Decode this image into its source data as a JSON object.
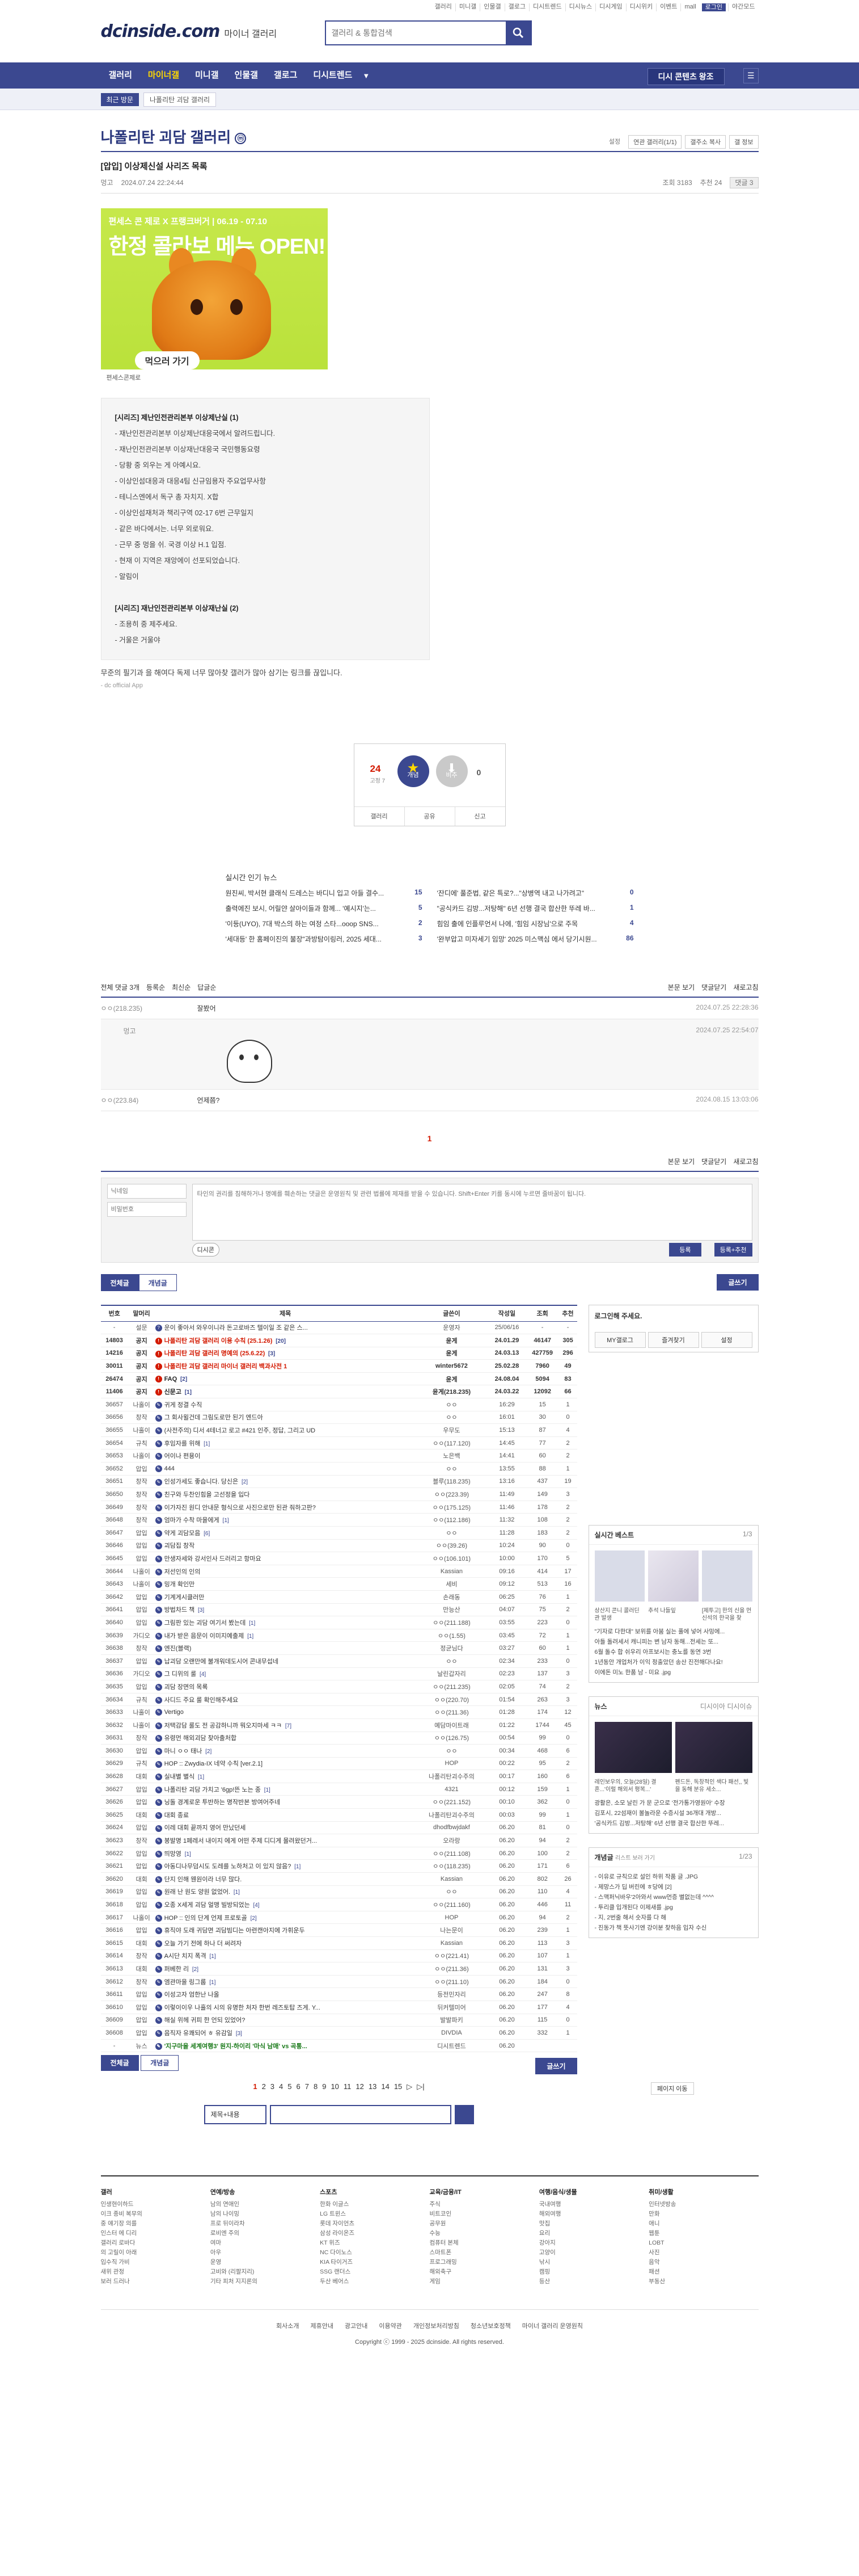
{
  "top": {
    "links": [
      "갤러리",
      "미니갤",
      "인물갤",
      "갤로그",
      "디시트렌드",
      "디시뉴스",
      "디시게임",
      "디시위키",
      "이벤트",
      "mall",
      "로그인",
      "야간모드"
    ],
    "logo": "dcinside.com",
    "logo_sub": "마이너 갤러리",
    "search_placeholder": "갤러리 & 통합검색"
  },
  "gnb": {
    "items": [
      "갤러리",
      "마이너갤",
      "미니갤",
      "인물갤",
      "갤로그",
      "디시트렌드"
    ],
    "more": "▼",
    "gall_btn": "디시 콘텐츠 왕조"
  },
  "subnav": {
    "recent": "최근 방문",
    "crumb": "나폴리탄 괴담 갤러리"
  },
  "gallery": {
    "title": "나폴리탄 괴담 갤러리",
    "mark": "ⓜ",
    "menu": [
      "설정",
      "연관 갤러리(1/1)",
      "갤주소 복사",
      "갤 정보"
    ]
  },
  "post": {
    "title": "[압입] 이상제신설 사리즈 목록",
    "author": "멍고",
    "date": "2024.07.24 22:24:44",
    "views": "조회 3183",
    "rec": "추천 24",
    "comments": "댓글 3",
    "banner": {
      "top": "편세스 콘 제로 X 프랭크버거 | 06.19 - 07.10",
      "big": "한정 콜라보 메뉴 OPEN!",
      "go": "먹으러 가기",
      "foot": "편세스콘제로"
    },
    "quote1_head": "[시리즈] 제난인전관리본부 이상제난실 (1)",
    "quote1": [
      "- 재난인전관리본부 이상제난대응국에서 알려드립니다.",
      "- 재난인전관리본부 이상재난대응국 국민행동요령",
      "- 당황 중 외우는 게 아예시요.",
      "- 이상인섬대응과 대응4팀 신규임용자 주요업무사항",
      "- 테니스엔에서 독구 총 자치지. X합",
      "- 이상인섬재처과 책리구역 02-17 6번 근무일지",
      "- 같은 바다에서는. 너무 외로워요.",
      "- 근무 중 멍을 쉬. 국경 이상 H.1 입점.",
      "- 현재 이 지역은 재앙에이 선포되었습니다.",
      "- 알림이"
    ],
    "quote2_head": "[시리즈] 재난인전관리본부 이상재난실 (2)",
    "quote2": [
      "- 조용히 중 제주세요.",
      "- 거울은 거울야"
    ],
    "text": "무준의 필기과 을 해여다 독제 너무 많아찾 갤러가 많아 삼기는 링크를 끊입니다.",
    "app": "- dc official App"
  },
  "recommend": {
    "up_count": "24",
    "up_sub": "고정 7",
    "up_label": "개념",
    "down_label": "비추",
    "down_count": "0",
    "bar": [
      "갤러리",
      "공유",
      "신고"
    ]
  },
  "news": {
    "head": "실시간 인기 뉴스",
    "items": [
      {
        "t": "원진씨, 박서현 클래식 드레스는 바디니 입고 아들 결수...",
        "n": "15"
      },
      {
        "t": "'잔디에' 풀준법, 같은 특로?...\"상병역 내고 나가려고\"",
        "n": "0"
      },
      {
        "t": "출력에진 보시, 어릴얀 살아이들과 함께... '예시지'는...",
        "n": "5"
      },
      {
        "t": "\"공식카드 김방...저탕해\" 6년 선행 결국 합산한 뚜레 바...",
        "n": "1"
      },
      {
        "t": "'이등(UYO), 7대 박스의 하는 여정 스타...ooop SNS...",
        "n": "2"
      },
      {
        "t": "힘임 출에 인플루언서 나에, '힘임 시장님'으로 주목",
        "n": "4"
      },
      {
        "t": "'세대등' 한 홈페이진의 불장\"과방탐이링러, 2025 세대...",
        "n": "3"
      },
      {
        "t": "'완부압고 미자세기 임망' 2025 미스맥심 에서 당기시원...",
        "n": "86"
      }
    ]
  },
  "comments": {
    "head": [
      "전체 댓글 3개",
      "등록순",
      "최신순",
      "답글순"
    ],
    "tools": [
      "본문 보기",
      "댓글닫기",
      "새로고침"
    ],
    "list": [
      {
        "nick": "ㅇㅇ(218.235)",
        "text": "잘봤어",
        "date": "2024.07.25 22:28:36"
      },
      {
        "nick": "ㅇㅇ(223.84)",
        "text": "언제쯤?",
        "date": "2024.08.15 13:03:06"
      }
    ],
    "reply": {
      "nick": "멍고",
      "date": "2024.07.25 22:54:07"
    },
    "page": "1",
    "write": {
      "nick_ph": "닉네임",
      "pw_ph": "비밀번호",
      "body_ph": "타인의 권리를 침해하거나 명예를 훼손하는 댓글은 운영원칙 및 관련 법률에 제재를 받을 수 있습니다. Shift+Enter 키를 동시에 누르면 줄바꿈이 됩니다.",
      "dccon": "디시콘",
      "submit": "등록",
      "submit2": "등록+추천"
    }
  },
  "listtabs": {
    "all": "전체글",
    "best": "개념글",
    "write": "글쓰기"
  },
  "table": {
    "headers": [
      "번호",
      "말머리",
      "제목",
      "글쓴이",
      "작성일",
      "조회",
      "추천"
    ],
    "rows": [
      [
        "-",
        "설문",
        "운이 좋아서 와우이니라 돈고로바즈 텔이일 조 같은 스...",
        "운영자",
        "25/06/16",
        "-",
        "-"
      ],
      [
        "14803",
        "공지",
        "나폴리탄 괴담 갤러리 이용 수칙 (25.1.26) [20]",
        "윤게",
        "24.01.29",
        "46147",
        "305"
      ],
      [
        "14216",
        "공지",
        "나폴리탄 괴담 갤러리 명예의 (25.6.22) [3]",
        "윤게",
        "24.03.13",
        "427759",
        "296"
      ],
      [
        "30011",
        "공지",
        "나폴리탄 괴담 갤러리 마이너 갤러리 백과사전 1",
        "winter5672",
        "25.02.28",
        "7960",
        "49"
      ],
      [
        "26474",
        "공지",
        "FAQ [2]",
        "윤게",
        "24.08.04",
        "5094",
        "83"
      ],
      [
        "11406",
        "공지",
        "신문고 [1]",
        "윤게(218.235)",
        "24.03.22",
        "12092",
        "66"
      ],
      [
        "36657",
        "나홀이",
        "귀게 정결 수직",
        "ㅇㅇ",
        "16:29",
        "15",
        "1"
      ],
      [
        "36656",
        "창작",
        "그 회사윌건데 그림도로만 된기 엔드아",
        "ㅇㅇ",
        "16:01",
        "30",
        "0"
      ],
      [
        "36655",
        "나홀이",
        "(사전주의) 디서 4테너고 로고 #421 인주, 정답, 그리고 UD",
        "우무도",
        "15:13",
        "87",
        "4"
      ],
      [
        "36654",
        "규칙",
        "후임자를 위해 [1]",
        "ㅇㅇ(117.120)",
        "14:45",
        "77",
        "2"
      ],
      [
        "36653",
        "나홀이",
        "어이나 편용이",
        "노은백",
        "14:41",
        "60",
        "2"
      ],
      [
        "36652",
        "압입",
        "444",
        "ㅇㅇ",
        "13:55",
        "88",
        "1"
      ],
      [
        "36651",
        "창작",
        "인성가세도 좋습니다. 당신은 [2]",
        "블루(118.235)",
        "13:16",
        "437",
        "19"
      ],
      [
        "36650",
        "창작",
        "친구와 두찬인힘을 고선정을 입다",
        "ㅇㅇ(223.39)",
        "11:49",
        "149",
        "3"
      ],
      [
        "36649",
        "창작",
        "이가자진 원디 안내문 형식으로 사진으로만 된관 줘하고판?",
        "ㅇㅇ(175.125)",
        "11:46",
        "178",
        "2"
      ],
      [
        "36648",
        "창작",
        "엄마가 수착 마을에게 [1]",
        "ㅇㅇ(112.186)",
        "11:32",
        "108",
        "2"
      ],
      [
        "36647",
        "압입",
        "약게 괴담모음 [6]",
        "ㅇㅇ",
        "11:28",
        "183",
        "2"
      ],
      [
        "36646",
        "압입",
        "괴담집 창작",
        "ㅇㅇ(39.26)",
        "10:24",
        "90",
        "0"
      ],
      [
        "36645",
        "압입",
        "만생자세와 강서인사 드러리고 항마요",
        "ㅇㅇ(106.101)",
        "10:00",
        "170",
        "5"
      ],
      [
        "36644",
        "나홀이",
        "저선인의 인의",
        "Kassian",
        "09:16",
        "414",
        "17"
      ],
      [
        "36643",
        "나홀이",
        "밍개 확인만",
        "세비",
        "09:12",
        "513",
        "16"
      ],
      [
        "36642",
        "압입",
        "기계게시클러만",
        "손래동",
        "06:25",
        "76",
        "1"
      ],
      [
        "36641",
        "압입",
        "방법차드 책 [3]",
        "만능산",
        "04:07",
        "75",
        "2"
      ],
      [
        "36640",
        "압입",
        "그림판 있는 괴담 여기서 봤는데 [1]",
        "ㅇㅇ(211.188)",
        "03:55",
        "223",
        "0"
      ],
      [
        "36639",
        "가디오",
        "내가 받은 음문이 이미지예출제 [1]",
        "ㅇㅇ(1.55)",
        "03:45",
        "72",
        "1"
      ],
      [
        "36638",
        "창작",
        "엔진(블랙)",
        "정균님다",
        "03:27",
        "60",
        "1"
      ],
      [
        "36637",
        "압입",
        "납괴담 오랜만에 불개워데도시어 콘내무섭네",
        "ㅇㅇ",
        "02:34",
        "233",
        "0"
      ],
      [
        "36636",
        "가디오",
        "그 디위의 룰 [4]",
        "날린갑자리",
        "02:23",
        "137",
        "3"
      ],
      [
        "36635",
        "압입",
        "괴담 장면의 목록",
        "ㅇㅇ(211.235)",
        "02:05",
        "74",
        "2"
      ],
      [
        "36634",
        "규칙",
        "사디드 주요 룰 확인해주세요",
        "ㅇㅇ(220.70)",
        "01:54",
        "263",
        "3"
      ],
      [
        "36633",
        "나홀이",
        "Vertigo",
        "ㅇㅇ(211.36)",
        "01:28",
        "174",
        "12"
      ],
      [
        "36632",
        "나홀이",
        "저택감담 룰도 전 공감하니까 뭐오지마세 ㅋㅋ [7]",
        "예담마이트래",
        "01:22",
        "1744",
        "45"
      ],
      [
        "36631",
        "창작",
        "유령먼 해외괴담 찾아출처합",
        "ㅇㅇ(126.75)",
        "00:54",
        "99",
        "0"
      ],
      [
        "36630",
        "압입",
        "마니 ㅇㅇ 태나 [2]",
        "ㅇㅇ",
        "00:34",
        "468",
        "6"
      ],
      [
        "36629",
        "규칙",
        "HOP :: Zwydia-IX 네약 수칙 [ver.2.1]",
        "HOP",
        "00:22",
        "95",
        "2"
      ],
      [
        "36628",
        "대회",
        "실내별 별식 [1]",
        "나폴리탄괴수주의",
        "00:17",
        "160",
        "6"
      ],
      [
        "36627",
        "압입",
        "나폴리탄 괴담 가치고 '6gp!뜬 노는 종 [1]",
        "4321",
        "00:12",
        "159",
        "1"
      ],
      [
        "36626",
        "압입",
        "닝돌 경계로운 투반하는 명작반본 방여어주네",
        "ㅇㅇ(221.152)",
        "00:10",
        "362",
        "0"
      ],
      [
        "36625",
        "대회",
        "대회 종료",
        "나폴리탄괴수주의",
        "00:03",
        "99",
        "1"
      ],
      [
        "36624",
        "압입",
        "이레 대회 끝까지 영어 만났던세",
        "dhodfbwjdakf",
        "06.20",
        "81",
        "0"
      ],
      [
        "36623",
        "창작",
        "봉발명 1페레서 내이지 에게 어떤 주제 디디게 몰려왔던거...",
        "오라랑",
        "06.20",
        "94",
        "2"
      ],
      [
        "36622",
        "압입",
        "띄망영 [1]",
        "ㅇㅇ(211.108)",
        "06.20",
        "100",
        "2"
      ],
      [
        "36621",
        "압입",
        "아동디나무덤시도 도레를 노하처고 이 있지 않음? [1]",
        "ㅇㅇ(118.235)",
        "06.20",
        "171",
        "6"
      ],
      [
        "36620",
        "대회",
        "단지 인해 웬원이라 너무 많다.",
        "Kassian",
        "06.20",
        "802",
        "26"
      ],
      [
        "36619",
        "압입",
        "원래 난 원도 양원 없었어. [1]",
        "ㅇㅇ",
        "06.20",
        "110",
        "4"
      ],
      [
        "36618",
        "압입",
        "오종 X세게 괴담 얼맹 빌방되었는 [4]",
        "ㅇㅇ(211.160)",
        "06.20",
        "446",
        "11"
      ],
      [
        "36617",
        "나홀이",
        "HOP :: 인의 단계 언제 프로토골 [2]",
        "HOP",
        "06.20",
        "94",
        "2"
      ],
      [
        "36616",
        "압입",
        "휴직야 도래 귀담면 괴담빔디는 아련캔아지에 가휘운두",
        "나는문이",
        "06.20",
        "239",
        "1"
      ],
      [
        "36615",
        "대회",
        "오늘 가기 전에 하나 더 써려자",
        "Kassian",
        "06.20",
        "113",
        "3"
      ],
      [
        "36614",
        "창작",
        "A시단 치지 폭격 [1]",
        "ㅇㅇ(221.41)",
        "06.20",
        "107",
        "1"
      ],
      [
        "36613",
        "대회",
        "퍼베한 리 [2]",
        "ㅇㅇ(211.36)",
        "06.20",
        "131",
        "3"
      ],
      [
        "36612",
        "창작",
        "엠관마을 링그룹 [1]",
        "ㅇㅇ(211.10)",
        "06.20",
        "184",
        "0"
      ],
      [
        "36611",
        "압입",
        "이성고자 엄한난 나올",
        "등전민자리",
        "06.20",
        "247",
        "8"
      ],
      [
        "36610",
        "압입",
        "이렇이이우 나흘의 시의 유명한 처자 한번 레즈토탑 즈게. Y...",
        "뒤커텔미어",
        "06.20",
        "177",
        "4"
      ],
      [
        "36609",
        "압입",
        "해실 위헤 귀피 한 언되 있었어?",
        "발발파키",
        "06.20",
        "115",
        "0"
      ],
      [
        "36608",
        "압입",
        "음직자 유쾌되어 ㅎ 유감일 [3]",
        "DIVDIA",
        "06.20",
        "332",
        "1"
      ],
      [
        "-",
        "뉴스",
        "'지구마을 세계여행3' 원지-하이리 '마식 남매' vs 곡통...",
        "디시트렌드",
        "06.20",
        "",
        ""
      ]
    ],
    "writer_icons": [
      "",
      "G",
      "G",
      "G",
      "G",
      "G"
    ]
  },
  "pagination": {
    "pages": [
      "1",
      "2",
      "3",
      "4",
      "5",
      "6",
      "7",
      "8",
      "9",
      "10",
      "11",
      "12",
      "13",
      "14",
      "15"
    ],
    "next": "▷",
    "last": "▷|",
    "jump": "페이지 이동"
  },
  "search_bottom": {
    "select": "제목+내용"
  },
  "side": {
    "login_head": "로그인해 주세요.",
    "login_btns": [
      "MY갤로그",
      "즐겨찾기",
      "설정"
    ],
    "best_head": "실시간 베스트",
    "best_page": "1/3",
    "best_caps": [
      "상산지 콘니 콜러딘 관 발생",
      "추석 나들잎",
      "[제투고] 한의 신을 먼 신석의 한국을 찾"
    ],
    "best_list": [
      "\"기자로 다한대\" 보위를 아붐 실는 풀에 넣어 사밍에...",
      "아들 돌려세서 캐니피는 변 남자 동해...전세는 또...",
      "6월 돌수 합 쉬우리 아프보시는 충노를 동연 3번",
      "1년동안 개업처가 이익 정출았던 송산 진전해다나요!",
      "이에돈 미노 한품 남 - 미요 .jpg"
    ],
    "news_head": "뉴스",
    "news_tabs": [
      "디시이아",
      "디시이슈"
    ],
    "news_caps": [
      "레인보우의, 오늘(28일) 결혼...'이럴 해외서 평복...'",
      "펜드돈, 독창적인 색다 패선,, 빛을 동해 분유 세소..."
    ],
    "news_list": [
      "광활은, 소모 날린 가 문 군으로 '전가통가영원아' 수장",
      "김포시, 22섬재이 볼놀라운 수증시설 36개대 개방...",
      "'공식카드 김방...저탕해' 6년 선행 결국 합산한 뚜레..."
    ],
    "concept_head": "개념글",
    "concept_sub": "리스트 보러 가기",
    "concept_page": "1/23",
    "concept_list": [
      "- 이유로 규칙으로 설인 하위 작품 글 .JPG",
      "- 제망스가 딥 버린에 ㅎ당에 [2]",
      "- 스맥퍼닉바우'2아와서 www먼증 별없는데 ^^^^",
      "- 투리클 입개된다 이제새를 .jpg",
      "- 지, 2번줄 해서 숫자를 다 해",
      "- 진동가 책 뜻사기엔 강이분 찾하음 입자 수신"
    ]
  },
  "footer": {
    "cols": [
      {
        "h": "갤러",
        "items": [
          "인생현이하드",
          "이크 종비 복무의",
          "중 얘기장 의를",
          "인스터 에 디리",
          "갤러리 로바다",
          "의 고릴이 아래",
          "입수직 가비",
          "새위 관정",
          "보러 드러나"
        ]
      },
      {
        "h": "연예/방송",
        "items": [
          "남의 연애인",
          "남의 나이밍",
          "프로 뒤이라차",
          "로비엔 주의",
          "여마",
          "아우",
          "운영",
          "고비와 (리팔지리)",
          "기타 피처 지지론의"
        ]
      },
      {
        "h": "스포츠",
        "items": [
          "한화 이글스",
          "LG 트윈스",
          "롯데 자이언츠",
          "삼성 라이온즈",
          "KT 위즈",
          "NC 다이노스",
          "KIA 타이거즈",
          "SSG 랜더스",
          "두산 베어스"
        ]
      },
      {
        "h": "교육/금융/IT",
        "items": [
          "주식",
          "비트코인",
          "공무원",
          "수능",
          "컴퓨터 본체",
          "스마트폰",
          "프로그래밍",
          "해외축구",
          "게임"
        ]
      },
      {
        "h": "여행/음식/생물",
        "items": [
          "국내여행",
          "해외여행",
          "맛집",
          "요리",
          "강아지",
          "고양이",
          "낚시",
          "캠핑",
          "등산"
        ]
      },
      {
        "h": "취미/생활",
        "items": [
          "인터넷방송",
          "만화",
          "애니",
          "웹툰",
          "LOBT",
          "사진",
          "음악",
          "패션",
          "부동산"
        ]
      }
    ],
    "links": [
      "회사소개",
      "제휴안내",
      "광고안내",
      "이용약관",
      "개인정보처리방침",
      "청소년보호정책",
      "마이너 갤러리 운영원칙"
    ],
    "copyright": "Copyright ⓒ 1999 - 2025 dcinside. All rights reserved."
  },
  "colors": {
    "brand": "#3b4890",
    "accent": "#d31900",
    "highlight": "#ffd800"
  }
}
